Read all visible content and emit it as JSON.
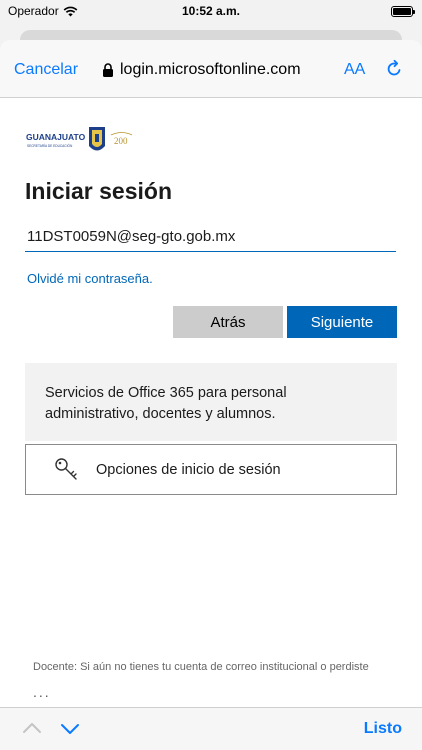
{
  "status_bar": {
    "carrier": "Operador",
    "time": "10:52 a.m."
  },
  "nav": {
    "cancel_label": "Cancelar",
    "url_text": "login.microsoftonline.com",
    "text_size_label": "AA",
    "icons": {
      "lock": "lock-icon",
      "reload": "reload-icon"
    }
  },
  "logo": {
    "name": "GUANAJUATO",
    "subtitle": "SECRETARÍA DE EDUCACIÓN",
    "badge": "200"
  },
  "signin": {
    "heading": "Iniciar sesión",
    "email_value": "11DST0059N@seg-gto.gob.mx",
    "forgot_link": "Olvidé mi contraseña.",
    "back_label": "Atrás",
    "next_label": "Siguiente"
  },
  "info": {
    "description": "Servicios de Office 365 para personal administrativo, docentes y alumnos.",
    "options_label": "Opciones de inicio de sesión"
  },
  "footer": {
    "text": "Docente: Si aún no tienes tu cuenta de correo institucional o perdiste",
    "dots": "..."
  },
  "toolbar": {
    "done_label": "Listo"
  },
  "colors": {
    "accent": "#0a7aff",
    "ms_blue": "#0067b8",
    "secondary_button": "#cccccc",
    "info_bg": "#f2f2f2"
  }
}
